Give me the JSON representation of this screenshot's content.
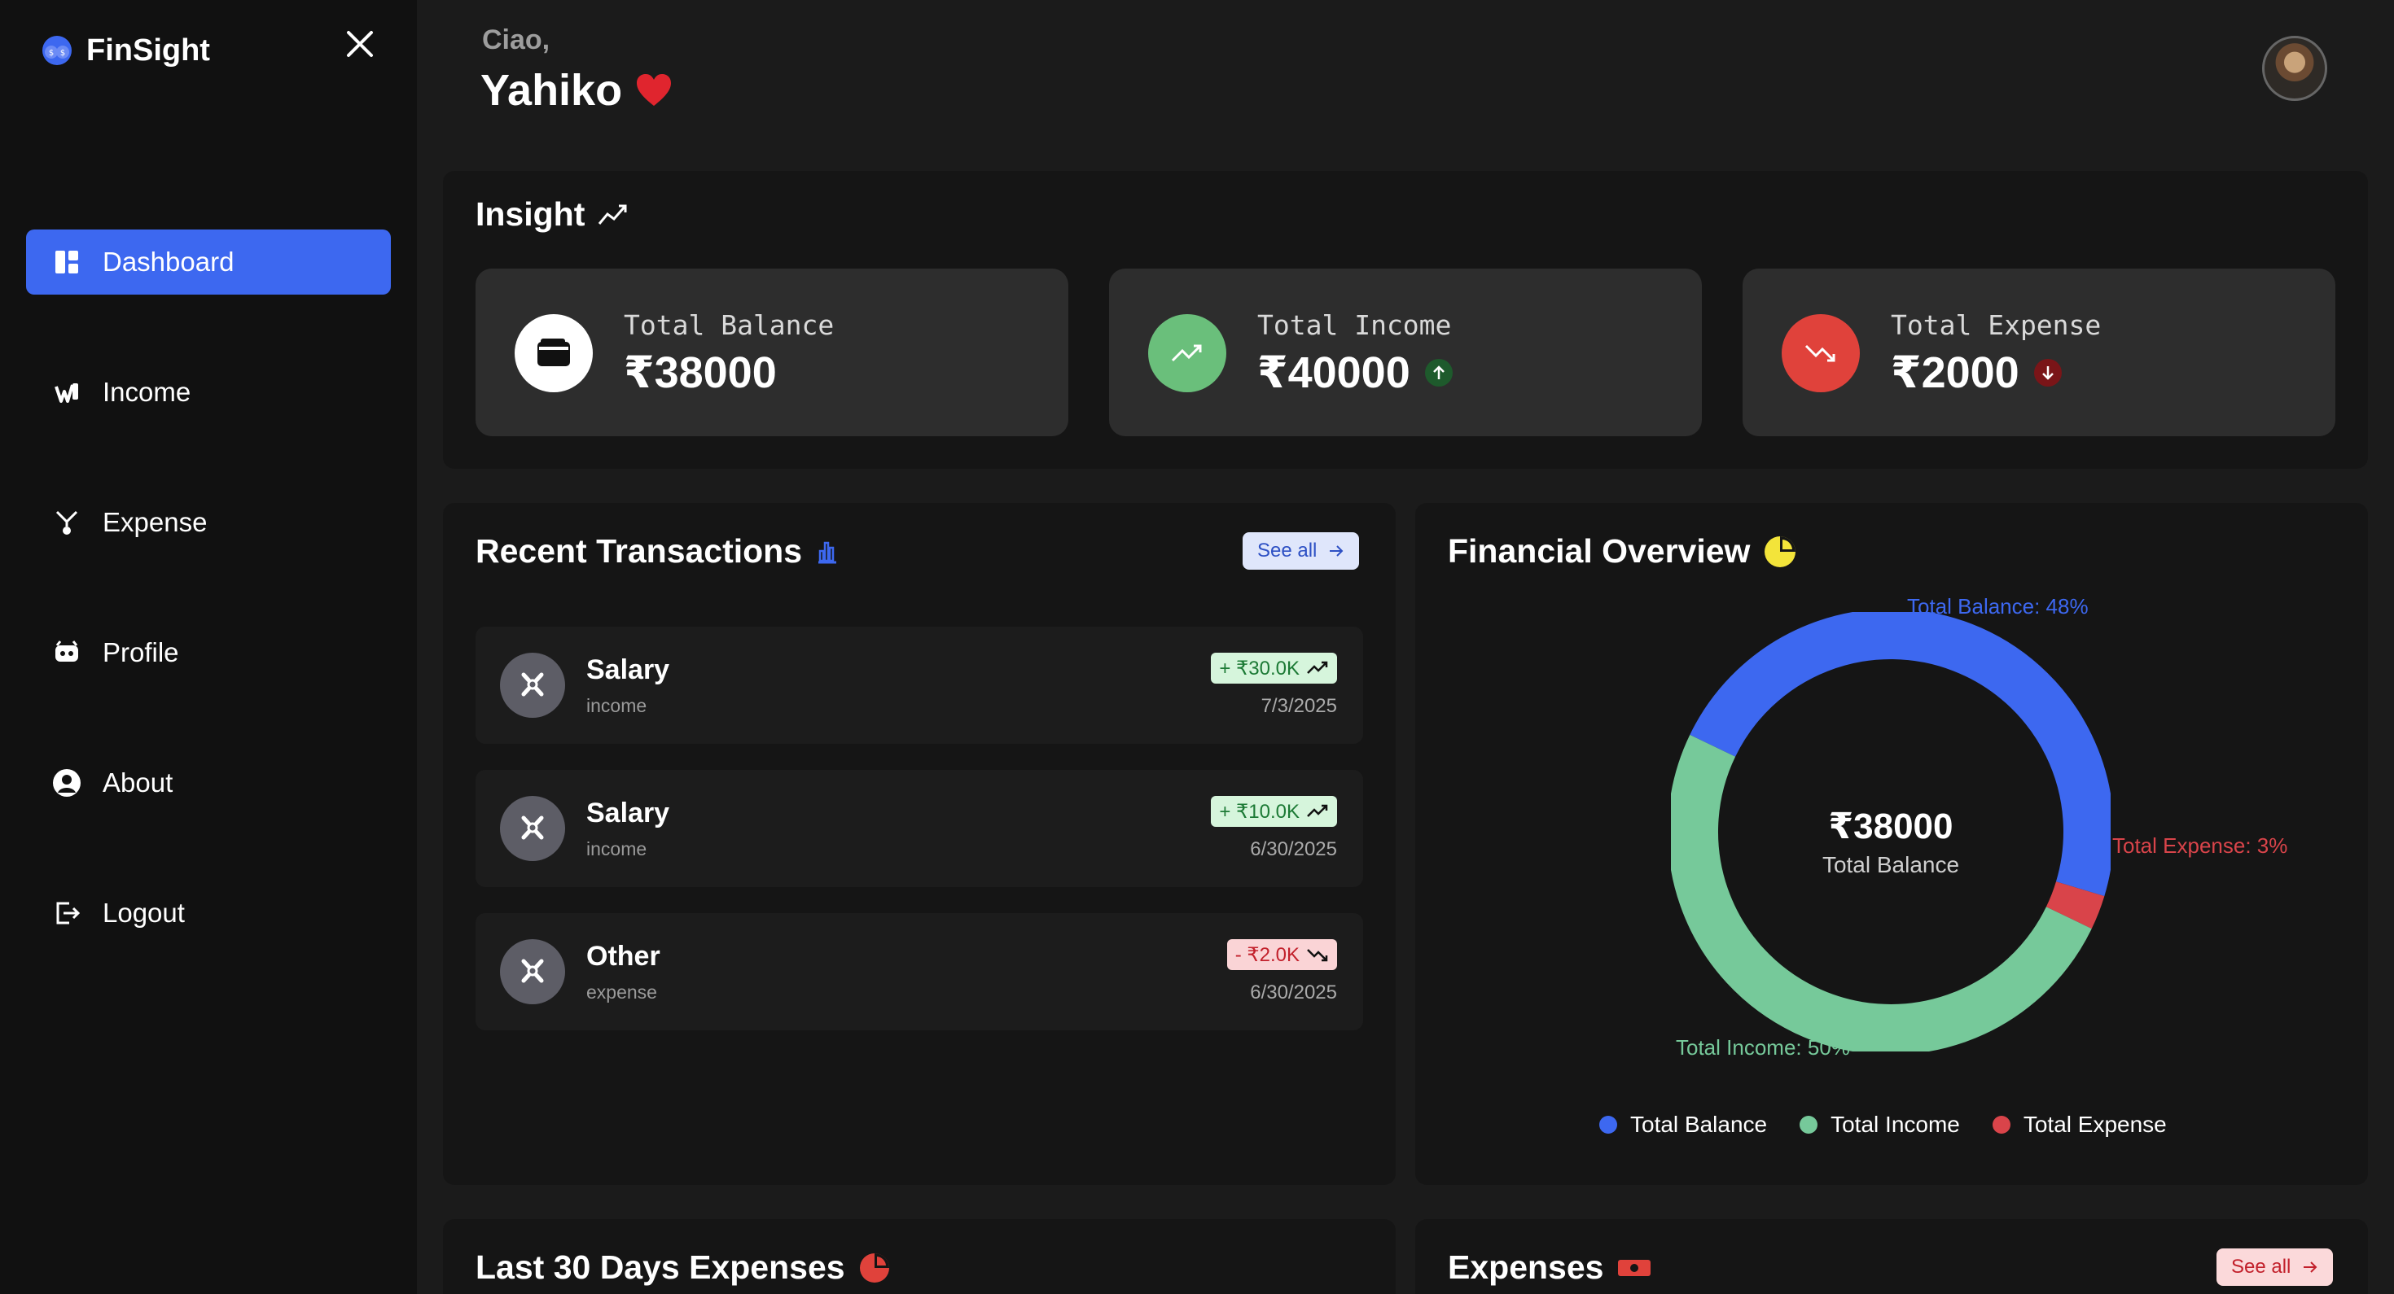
{
  "app": {
    "name": "FinSight"
  },
  "sidebar": {
    "items": [
      {
        "label": "Dashboard",
        "icon": "dashboard-icon",
        "active": true
      },
      {
        "label": "Income",
        "icon": "income-icon"
      },
      {
        "label": "Expense",
        "icon": "expense-icon"
      },
      {
        "label": "Profile",
        "icon": "profile-icon"
      },
      {
        "label": "About",
        "icon": "about-icon"
      },
      {
        "label": "Logout",
        "icon": "logout-icon"
      }
    ]
  },
  "header": {
    "greeting": "Ciao,",
    "username": "Yahiko"
  },
  "insight": {
    "title": "Insight",
    "cards": [
      {
        "label": "Total Balance",
        "value": "₹38000",
        "icon": "wallet-icon",
        "color": "#ffffff"
      },
      {
        "label": "Total Income",
        "value": "₹40000",
        "icon": "trending-up-icon",
        "color": "#6abf7b"
      },
      {
        "label": "Total Expense",
        "value": "₹2000",
        "icon": "trending-down-icon",
        "color": "#e0423b"
      }
    ]
  },
  "recent": {
    "title": "Recent Transactions",
    "see_all": "See all",
    "items": [
      {
        "name": "Salary",
        "category": "income",
        "amount": "+ ₹30.0K",
        "date": "7/3/2025",
        "type": "income"
      },
      {
        "name": "Salary",
        "category": "income",
        "amount": "+ ₹10.0K",
        "date": "6/30/2025",
        "type": "income"
      },
      {
        "name": "Other",
        "category": "expense",
        "amount": "- ₹2.0K",
        "date": "6/30/2025",
        "type": "expense"
      }
    ]
  },
  "overview": {
    "title": "Financial Overview",
    "center_value": "₹38000",
    "center_label": "Total Balance",
    "labels": {
      "balance": "Total Balance: 48%",
      "expense": "Total Expense: 3%",
      "income": "Total Income: 50%"
    },
    "legend": [
      "Total Balance",
      "Total Income",
      "Total Expense"
    ]
  },
  "bottom": {
    "last30_title": "Last 30 Days Expenses",
    "expenses_title": "Expenses",
    "expenses_see_all": "See all"
  },
  "chart_data": {
    "type": "pie",
    "categories": [
      "Total Balance",
      "Total Income",
      "Total Expense"
    ],
    "values": [
      38000,
      40000,
      2000
    ],
    "percent_labels": [
      48,
      50,
      3
    ],
    "colors": [
      "#3d68f0",
      "#76c99a",
      "#d9444a"
    ],
    "title": "Financial Overview",
    "legend": "bottom"
  }
}
